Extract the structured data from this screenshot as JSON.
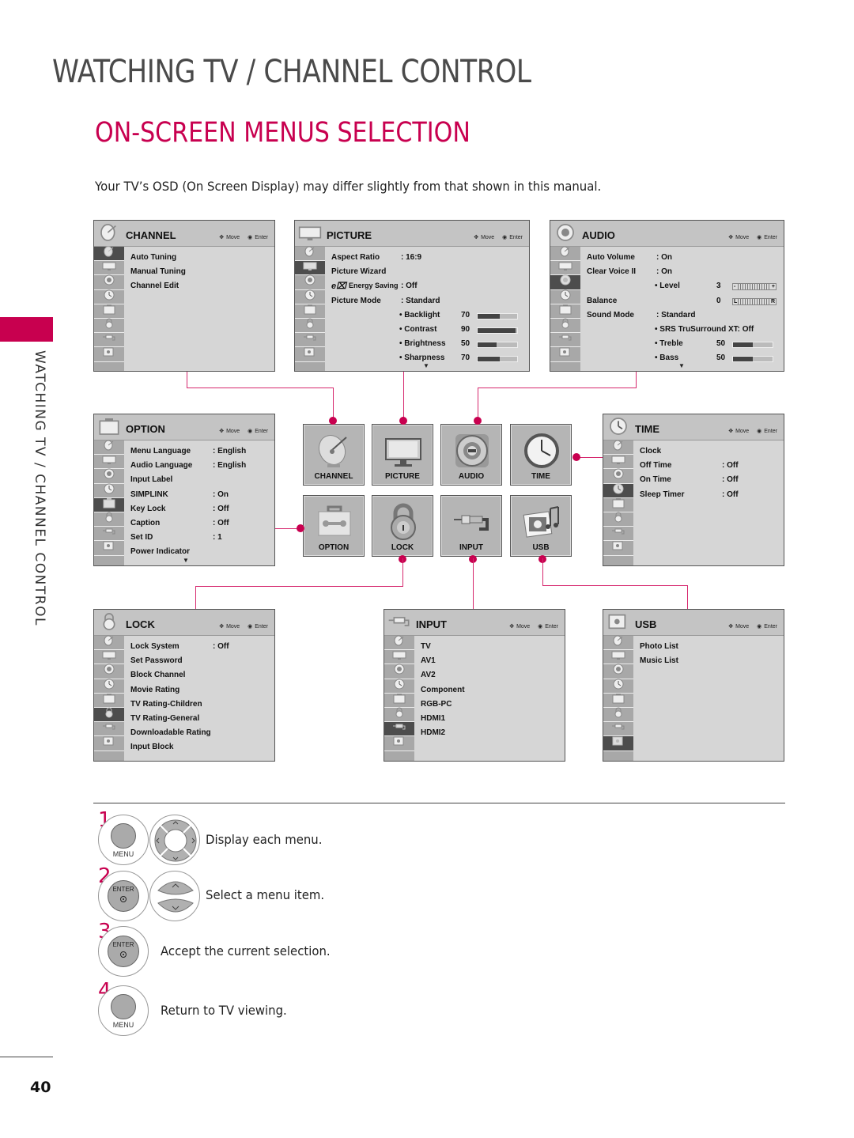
{
  "page": {
    "section_title": "WATCHING TV / CHANNEL CONTROL",
    "heading": "ON-SCREEN MENUS SELECTION",
    "intro": "Your TV’s OSD (On Screen Display) may differ slightly from that shown in this manual.",
    "side_label": "WATCHING TV / CHANNEL CONTROL",
    "page_number": "40",
    "accent_color": "#c8004f"
  },
  "nav_hint": {
    "move": "Move",
    "enter": "Enter"
  },
  "menus": {
    "channel": {
      "title": "CHANNEL",
      "selected_rail": 0,
      "rows": [
        {
          "label": "Auto Tuning"
        },
        {
          "label": "Manual Tuning"
        },
        {
          "label": "Channel Edit"
        }
      ]
    },
    "picture": {
      "title": "PICTURE",
      "selected_rail": 1,
      "rows": [
        {
          "label": "Aspect Ratio",
          "value": ": 16:9"
        },
        {
          "label": "Picture Wizard"
        },
        {
          "label": "Energy Saving",
          "value": ": Off",
          "icon": "energy-saving-icon"
        },
        {
          "label": "Picture Mode",
          "value": ": Standard"
        },
        {
          "sub": "• Backlight",
          "num": "70",
          "level": 0.55
        },
        {
          "sub": "• Contrast",
          "num": "90",
          "level": 0.95
        },
        {
          "sub": "• Brightness",
          "num": "50",
          "level": 0.48
        },
        {
          "sub": "• Sharpness",
          "num": "70",
          "level": 0.55
        }
      ],
      "more_indicator": "▼"
    },
    "audio": {
      "title": "AUDIO",
      "selected_rail": 2,
      "rows": [
        {
          "label": "Auto Volume",
          "value": ": On"
        },
        {
          "label": "Clear Voice II",
          "value": ": On"
        },
        {
          "sub": "• Level",
          "num": "3",
          "scale_left": "-",
          "scale_right": "+"
        },
        {
          "label": "Balance",
          "num": "0",
          "scale_left": "L",
          "scale_right": "R"
        },
        {
          "label": "Sound Mode",
          "value": ": Standard"
        },
        {
          "sub": "• SRS TruSurround XT:  Off"
        },
        {
          "sub": "• Treble",
          "num": "50",
          "level": 0.5
        },
        {
          "sub": "• Bass",
          "num": "50",
          "level": 0.5
        }
      ],
      "more_indicator": "▼"
    },
    "option": {
      "title": "OPTION",
      "selected_rail": 4,
      "rows": [
        {
          "label": "Menu Language",
          "value": ": English"
        },
        {
          "label": "Audio Language",
          "value": ": English"
        },
        {
          "label": "Input Label"
        },
        {
          "label": "SIMPLINK",
          "value": ": On"
        },
        {
          "label": "Key Lock",
          "value": ": Off"
        },
        {
          "label": "Caption",
          "value": ": Off"
        },
        {
          "label": "Set ID",
          "value": ": 1"
        },
        {
          "label": "Power Indicator"
        }
      ],
      "more_indicator": "▼"
    },
    "time": {
      "title": "TIME",
      "selected_rail": 3,
      "rows": [
        {
          "label": "Clock"
        },
        {
          "label": "Off Time",
          "value": ": Off"
        },
        {
          "label": "On Time",
          "value": ": Off"
        },
        {
          "label": "Sleep Timer",
          "value": ": Off"
        }
      ]
    },
    "lock": {
      "title": "LOCK",
      "selected_rail": 5,
      "rows": [
        {
          "label": "Lock System",
          "value": ": Off"
        },
        {
          "label": "Set Password"
        },
        {
          "label": "Block Channel"
        },
        {
          "label": "Movie Rating"
        },
        {
          "label": "TV Rating-Children"
        },
        {
          "label": "TV Rating-General"
        },
        {
          "label": "Downloadable Rating"
        },
        {
          "label": "Input Block"
        }
      ]
    },
    "input": {
      "title": "INPUT",
      "selected_rail": 6,
      "rows": [
        {
          "label": "TV"
        },
        {
          "label": "AV1"
        },
        {
          "label": "AV2"
        },
        {
          "label": "Component"
        },
        {
          "label": "RGB-PC"
        },
        {
          "label": "HDMI1"
        },
        {
          "label": "HDMI2"
        }
      ]
    },
    "usb": {
      "title": "USB",
      "selected_rail": 7,
      "rows": [
        {
          "label": "Photo List"
        },
        {
          "label": "Music List"
        }
      ]
    }
  },
  "tiles": [
    {
      "label": "CHANNEL",
      "icon": "satellite-dish-icon"
    },
    {
      "label": "PICTURE",
      "icon": "tv-monitor-icon"
    },
    {
      "label": "AUDIO",
      "icon": "speaker-icon"
    },
    {
      "label": "TIME",
      "icon": "clock-icon"
    },
    {
      "label": "OPTION",
      "icon": "toolbox-icon"
    },
    {
      "label": "LOCK",
      "icon": "padlock-icon"
    },
    {
      "label": "INPUT",
      "icon": "av-cable-icon"
    },
    {
      "label": "USB",
      "icon": "photo-music-icon"
    }
  ],
  "steps": [
    {
      "number": "1",
      "button": "MENU",
      "text": "Display each menu."
    },
    {
      "number": "2",
      "button": "ENTER",
      "text": "Select a menu item."
    },
    {
      "number": "3",
      "button": "ENTER",
      "text": "Accept the current selection."
    },
    {
      "number": "4",
      "button": "MENU",
      "text": "Return to TV viewing."
    }
  ]
}
